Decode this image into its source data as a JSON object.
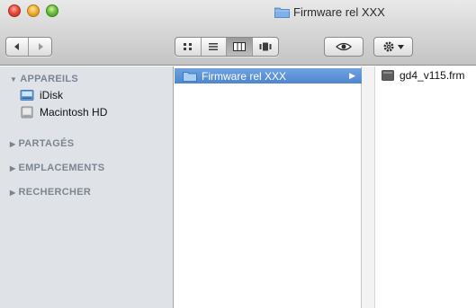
{
  "window": {
    "title": "Firmware rel XXX"
  },
  "toolbar": {
    "back_icon": "back-arrow-icon",
    "forward_icon": "forward-arrow-icon",
    "view_modes": [
      "icon-view-icon",
      "list-view-icon",
      "column-view-icon",
      "coverflow-view-icon"
    ],
    "active_view": "column-view-icon",
    "quicklook_icon": "eye-icon",
    "action_icon": "gear-icon"
  },
  "sidebar": {
    "sections": [
      {
        "label": "APPAREILS",
        "expanded": true,
        "items": [
          {
            "label": "iDisk",
            "icon": "idisk-icon"
          },
          {
            "label": "Macintosh HD",
            "icon": "hard-drive-icon"
          }
        ]
      },
      {
        "label": "PARTAGÉS",
        "expanded": false
      },
      {
        "label": "EMPLACEMENTS",
        "expanded": false
      },
      {
        "label": "RECHERCHER",
        "expanded": false
      }
    ]
  },
  "columns": {
    "col1": {
      "selected": "Firmware rel XXX"
    },
    "col2": {
      "file": "gd4_v115.frm"
    }
  },
  "colors": {
    "selection": "#5b8fd5",
    "sidebar_bg": "#dfe3e8",
    "sidebar_header": "#7b8592"
  }
}
